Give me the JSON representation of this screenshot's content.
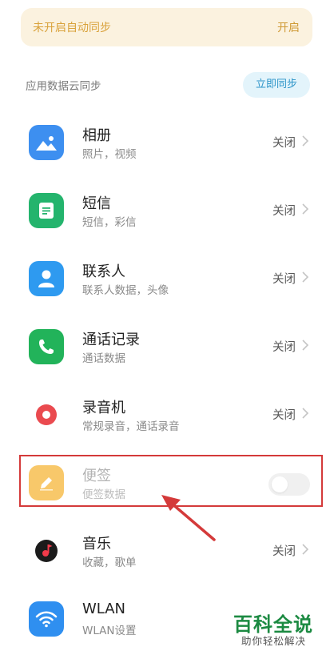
{
  "banner": {
    "text": "未开启自动同步",
    "action": "开启"
  },
  "section": {
    "label": "应用数据云同步",
    "sync_button": "立即同步"
  },
  "items": [
    {
      "title": "相册",
      "subtitle": "照片，视频",
      "state": "关闭",
      "icon": "gallery-icon"
    },
    {
      "title": "短信",
      "subtitle": "短信，彩信",
      "state": "关闭",
      "icon": "messages-icon"
    },
    {
      "title": "联系人",
      "subtitle": "联系人数据，头像",
      "state": "关闭",
      "icon": "contacts-icon"
    },
    {
      "title": "通话记录",
      "subtitle": "通话数据",
      "state": "关闭",
      "icon": "phone-icon"
    },
    {
      "title": "录音机",
      "subtitle": "常规录音，通话录音",
      "state": "关闭",
      "icon": "recorder-icon"
    },
    {
      "title": "便签",
      "subtitle": "便签数据",
      "state": "",
      "icon": "notes-icon",
      "toggle_on": false
    },
    {
      "title": "音乐",
      "subtitle": "收藏，歌单",
      "state": "关闭",
      "icon": "music-icon"
    },
    {
      "title": "WLAN",
      "subtitle": "WLAN设置",
      "state": "",
      "icon": "wifi-icon"
    }
  ],
  "watermark": {
    "main": "百科全说",
    "sub": "助你轻松解决"
  },
  "colors": {
    "banner_bg": "#fbf2df",
    "banner_text": "#d9a23b",
    "sync_bg": "#e3f4fb",
    "sync_text": "#2d95c9",
    "highlight": "#d43a3a",
    "watermark": "#1c8a42"
  }
}
